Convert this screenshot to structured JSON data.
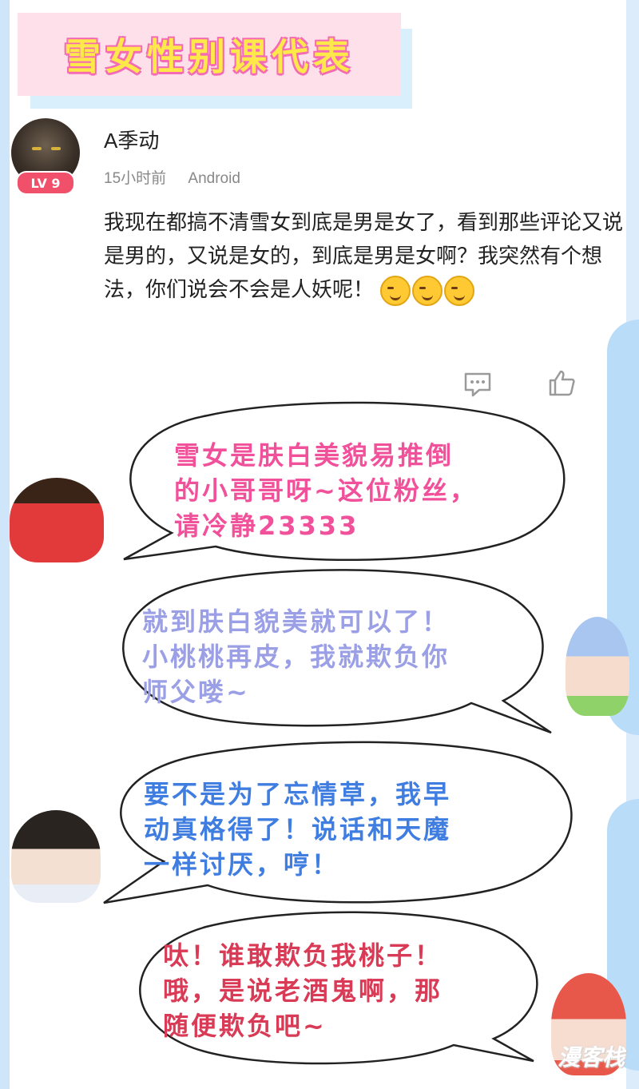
{
  "banner": {
    "title": "雪女性别课代表"
  },
  "post": {
    "username": "A季动",
    "level": "LV 9",
    "time": "15小时前",
    "device": "Android",
    "body_text": "我现在都搞不清雪女到底是男是女了，看到那些评论又说是男的，又说是女的，到底是男是女啊？我突然有个想法，你们说会不会是人妖呢！",
    "emojis": [
      "smirk-emoji",
      "smirk-emoji",
      "smirk-emoji"
    ]
  },
  "actions": {
    "comment_icon": "comment-icon",
    "like_icon": "thumbs-up-icon"
  },
  "bubbles": [
    {
      "lines": [
        "雪女是肤白美貌易推倒",
        "的小哥哥呀~这位粉丝，",
        "请冷静23333"
      ],
      "color": "#f1509a"
    },
    {
      "lines": [
        "就到肤白貌美就可以了！",
        "小桃桃再皮，我就欺负你",
        "师父喽~"
      ],
      "color": "#9a9fe6"
    },
    {
      "lines": [
        "要不是为了忘情草，我早",
        "动真格得了！说话和天魔",
        "一样讨厌，哼！"
      ],
      "color": "#3f7ee0"
    },
    {
      "lines": [
        "呔！谁敢欺负我桃子！",
        "哦，是说老酒鬼啊，那",
        "随便欺负吧~"
      ],
      "color": "#d93a55"
    }
  ],
  "watermark": "漫客栈",
  "colors": {
    "banner_bg": "#fde0ea",
    "banner_text": "#ffe94a",
    "banner_outline": "#f56ab5",
    "side": "#cfe6fa"
  }
}
